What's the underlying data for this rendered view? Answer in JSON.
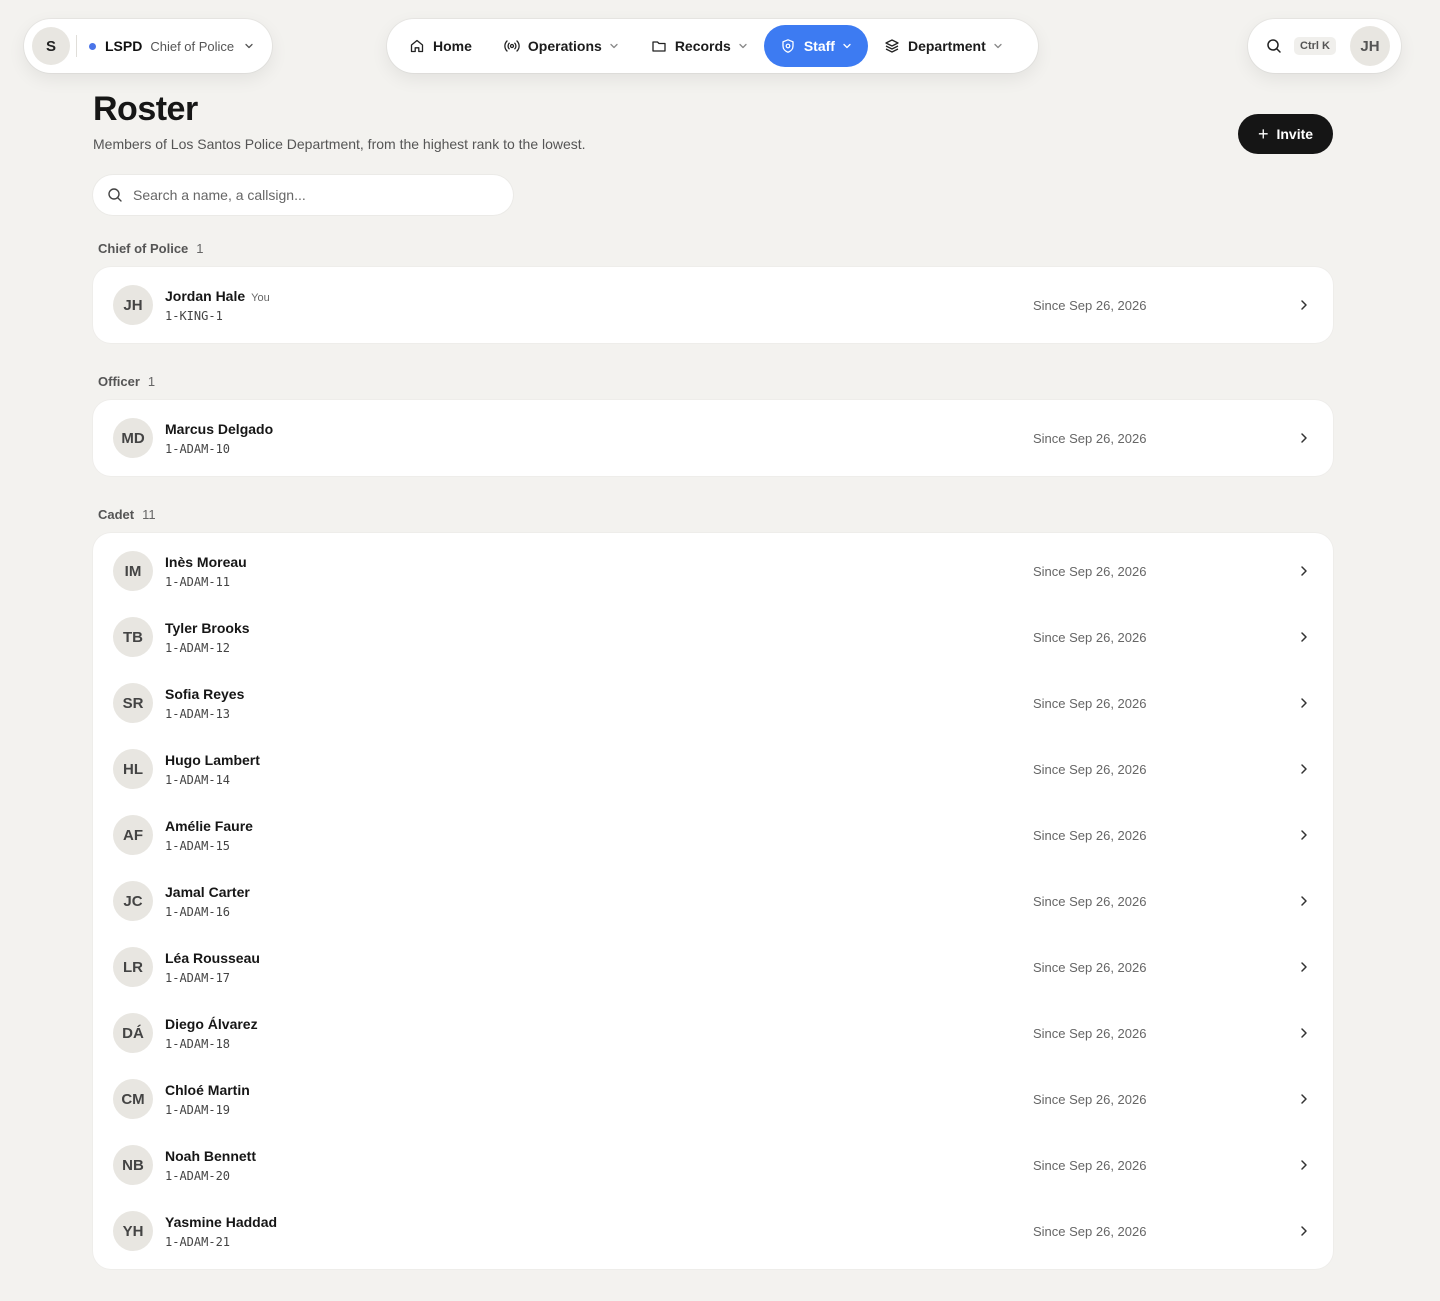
{
  "org": {
    "avatar": "S",
    "name": "LSPD",
    "role": "Chief of Police",
    "dot_color": "#4a74e8"
  },
  "nav": {
    "items": [
      {
        "label": "Home",
        "icon": "home-icon"
      },
      {
        "label": "Operations",
        "icon": "broadcast-icon"
      },
      {
        "label": "Records",
        "icon": "folder-icon"
      },
      {
        "label": "Staff",
        "icon": "shield-icon"
      },
      {
        "label": "Department",
        "icon": "layers-icon"
      }
    ],
    "active": "Staff",
    "active_color": "#3d7bf2"
  },
  "topright": {
    "shortcut": "Ctrl K",
    "user_initials": "JH"
  },
  "page": {
    "title": "Roster",
    "subtitle": "Members of Los Santos Police Department, from the highest rank to the lowest.",
    "invite_label": "Invite"
  },
  "search": {
    "placeholder": "Search a name, a callsign..."
  },
  "groups": [
    {
      "rank": "Chief of Police",
      "count": "1",
      "members": [
        {
          "initials": "JH",
          "name": "Jordan Hale",
          "you": "You",
          "callsign": "1-KING-1",
          "since": "Since Sep 26, 2026"
        }
      ]
    },
    {
      "rank": "Officer",
      "count": "1",
      "members": [
        {
          "initials": "MD",
          "name": "Marcus Delgado",
          "callsign": "1-ADAM-10",
          "since": "Since Sep 26, 2026"
        }
      ]
    },
    {
      "rank": "Cadet",
      "count": "11",
      "members": [
        {
          "initials": "IM",
          "name": "Inès Moreau",
          "callsign": "1-ADAM-11",
          "since": "Since Sep 26, 2026"
        },
        {
          "initials": "TB",
          "name": "Tyler Brooks",
          "callsign": "1-ADAM-12",
          "since": "Since Sep 26, 2026"
        },
        {
          "initials": "SR",
          "name": "Sofia Reyes",
          "callsign": "1-ADAM-13",
          "since": "Since Sep 26, 2026"
        },
        {
          "initials": "HL",
          "name": "Hugo Lambert",
          "callsign": "1-ADAM-14",
          "since": "Since Sep 26, 2026"
        },
        {
          "initials": "AF",
          "name": "Amélie Faure",
          "callsign": "1-ADAM-15",
          "since": "Since Sep 26, 2026"
        },
        {
          "initials": "JC",
          "name": "Jamal Carter",
          "callsign": "1-ADAM-16",
          "since": "Since Sep 26, 2026"
        },
        {
          "initials": "LR",
          "name": "Léa Rousseau",
          "callsign": "1-ADAM-17",
          "since": "Since Sep 26, 2026"
        },
        {
          "initials": "DÁ",
          "name": "Diego Álvarez",
          "callsign": "1-ADAM-18",
          "since": "Since Sep 26, 2026"
        },
        {
          "initials": "CM",
          "name": "Chloé Martin",
          "callsign": "1-ADAM-19",
          "since": "Since Sep 26, 2026"
        },
        {
          "initials": "NB",
          "name": "Noah Bennett",
          "callsign": "1-ADAM-20",
          "since": "Since Sep 26, 2026"
        },
        {
          "initials": "YH",
          "name": "Yasmine Haddad",
          "callsign": "1-ADAM-21",
          "since": "Since Sep 26, 2026"
        }
      ]
    }
  ]
}
